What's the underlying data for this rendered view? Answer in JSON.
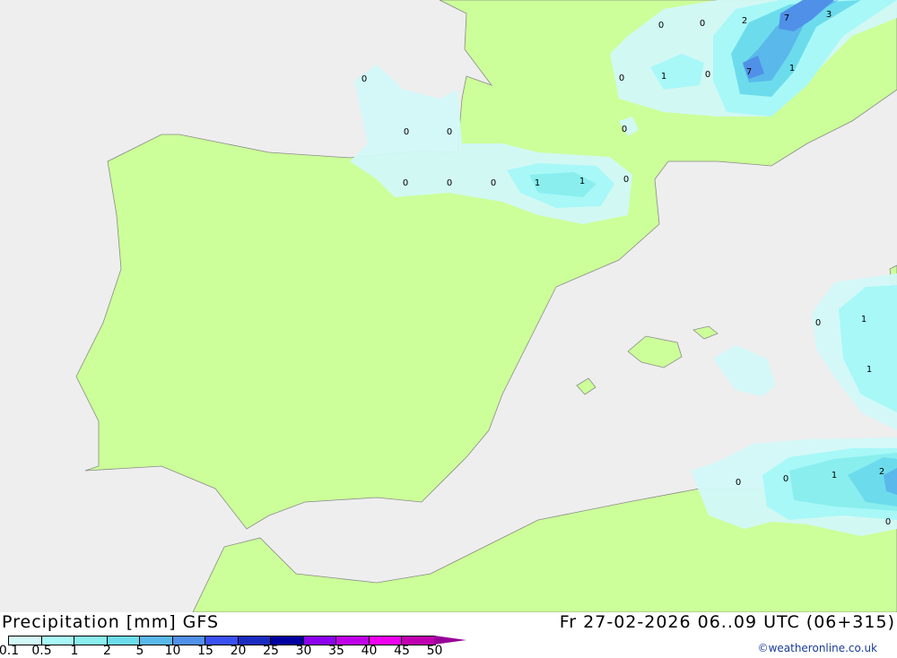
{
  "footer": {
    "title": "Precipitation [mm] GFS",
    "valid_time": "Fr 27-02-2026 06..09 UTC (06+315)",
    "credit": "©weatheronline.co.uk"
  },
  "legend": {
    "ticks": [
      "0.1",
      "0.5",
      "1",
      "2",
      "5",
      "10",
      "15",
      "20",
      "25",
      "30",
      "35",
      "40",
      "45",
      "50"
    ],
    "colors": [
      "#d2f8f8",
      "#a8f8f8",
      "#8aeeee",
      "#6cdcec",
      "#5ab8ea",
      "#5090e8",
      "#3a50f0",
      "#1a2cc0",
      "#0000a0",
      "#8c00f0",
      "#c000e8",
      "#f000f0",
      "#c000b0"
    ],
    "overflow_color": "#980098"
  },
  "map": {
    "colors": {
      "sea": "#eeeeee",
      "land": "#ccff99",
      "border": "#8a8a8a"
    },
    "labels": [
      "0",
      "0",
      "2",
      "7",
      "3",
      "0",
      "0",
      "1",
      "0",
      "7",
      "1",
      "0",
      "0",
      "0",
      "0",
      "0",
      "0",
      "1",
      "1",
      "0",
      "0",
      "1",
      "1",
      "0",
      "0",
      "1",
      "2",
      "0"
    ]
  }
}
